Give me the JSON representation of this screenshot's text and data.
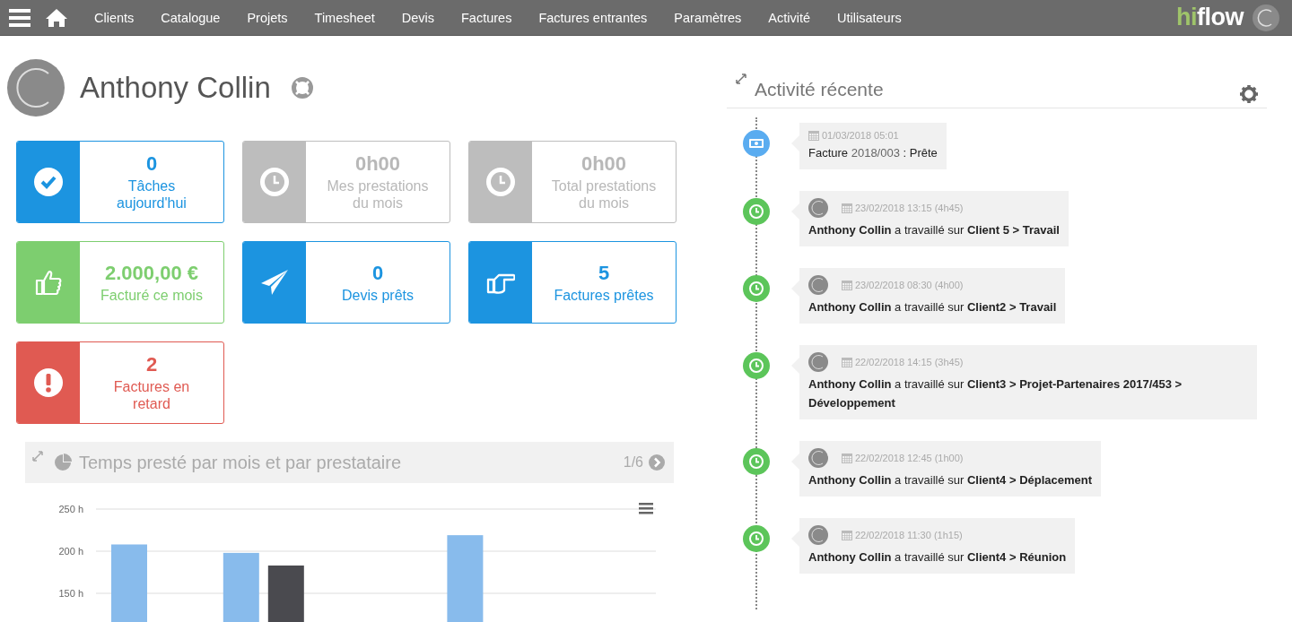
{
  "navbar": {
    "items": [
      {
        "label": "Clients"
      },
      {
        "label": "Catalogue"
      },
      {
        "label": "Projets"
      },
      {
        "label": "Timesheet"
      },
      {
        "label": "Devis"
      },
      {
        "label": "Factures"
      },
      {
        "label": "Factures entrantes"
      },
      {
        "label": "Paramètres"
      },
      {
        "label": "Activité"
      },
      {
        "label": "Utilisateurs"
      }
    ],
    "logo": {
      "accent": "hi",
      "rest": "flow"
    }
  },
  "profile": {
    "name": "Anthony Collin"
  },
  "stats": [
    {
      "kind": "tasks",
      "color": "#1c94e0",
      "value": "0",
      "label": "Tâches aujourd'hui"
    },
    {
      "kind": "time",
      "color": "#bdbdbd",
      "value": "0h00",
      "label": "Mes prestations du mois"
    },
    {
      "kind": "time",
      "color": "#bdbdbd",
      "value": "0h00",
      "label": "Total prestations du mois"
    },
    {
      "kind": "revenue",
      "color": "#7dce6f",
      "value": "2.000,00 €",
      "label": "Facturé ce mois"
    },
    {
      "kind": "quotes",
      "color": "#1c94e0",
      "value": "0",
      "label": "Devis prêts"
    },
    {
      "kind": "invoices",
      "color": "#1c94e0",
      "value": "5",
      "label": "Factures prêtes"
    },
    {
      "kind": "late",
      "color": "#e05a52",
      "value": "2",
      "label": "Factures en retard"
    }
  ],
  "chart_panel": {
    "title": "Temps presté par mois et par prestataire",
    "pager": "1/6",
    "chart_data": {
      "type": "bar",
      "grid": true,
      "ylim": [
        0,
        250
      ],
      "yticks": [
        {
          "value": 150,
          "label": "150 h"
        },
        {
          "value": 200,
          "label": "200 h"
        },
        {
          "value": 250,
          "label": "250 h"
        }
      ],
      "series": [
        {
          "color": "#88bbec",
          "values": [
            208,
            198,
            null,
            219,
            null
          ]
        },
        {
          "color": "#4a4a4f",
          "values": [
            null,
            183,
            null,
            null,
            null
          ]
        }
      ]
    }
  },
  "activity": {
    "title": "Activité récente",
    "items": [
      {
        "kind": "invoice",
        "date": "01/03/2018 05:01",
        "label": "Facture",
        "ref": "2018/003",
        "status": ": Prête"
      },
      {
        "kind": "work",
        "date": "23/02/2018 13:15 (4h45)",
        "text": "**Anthony Collin** a travaillé sur **Client 5 > Travail**"
      },
      {
        "kind": "work",
        "date": "23/02/2018 08:30 (4h00)",
        "text": "**Anthony Collin** a travaillé sur **Client2 > Travail**"
      },
      {
        "kind": "work",
        "date": "22/02/2018 14:15 (3h45)",
        "text": "**Anthony Collin** a travaillé sur **Client3 > Projet-Partenaires 2017/453 > Développement**"
      },
      {
        "kind": "work",
        "date": "22/02/2018 12:45 (1h00)",
        "text": "**Anthony Collin** a travaillé sur **Client4 > Déplacement**"
      },
      {
        "kind": "work",
        "date": "22/02/2018 11:30 (1h15)",
        "text": "**Anthony Collin** a travaillé sur **Client4 > Réunion**"
      }
    ]
  }
}
